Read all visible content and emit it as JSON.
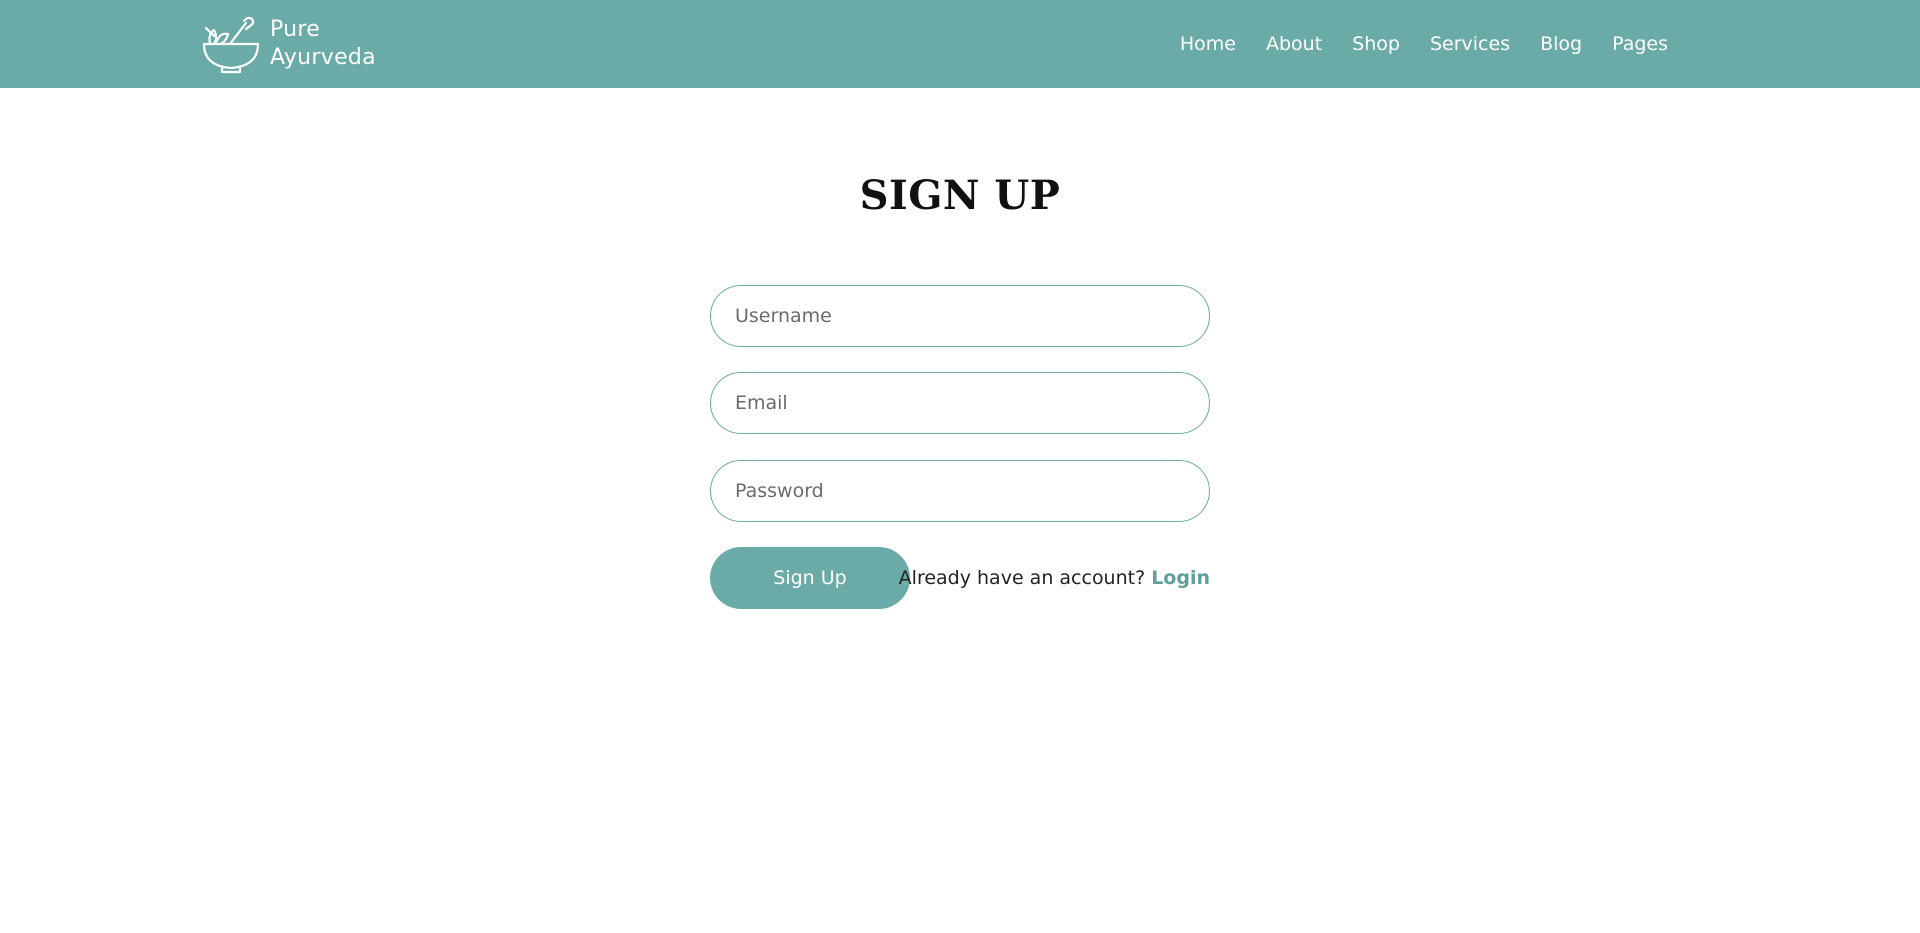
{
  "brand": {
    "line1": "Pure",
    "line2": "Ayurveda",
    "icon": "mortar-pestle-icon"
  },
  "nav": {
    "items": [
      {
        "label": "Home"
      },
      {
        "label": "About"
      },
      {
        "label": "Shop"
      },
      {
        "label": "Services"
      },
      {
        "label": "Blog"
      },
      {
        "label": "Pages"
      }
    ]
  },
  "form": {
    "title": "SIGN UP",
    "username": {
      "placeholder": "Username",
      "value": ""
    },
    "email": {
      "placeholder": "Email",
      "value": ""
    },
    "password": {
      "placeholder": "Password",
      "value": ""
    },
    "submit_label": "Sign Up",
    "login_prompt": "Already have an account?",
    "login_link": "Login"
  },
  "colors": {
    "accent": "#6aaaa7",
    "link": "#5f9f9c",
    "heading": "#111111"
  }
}
